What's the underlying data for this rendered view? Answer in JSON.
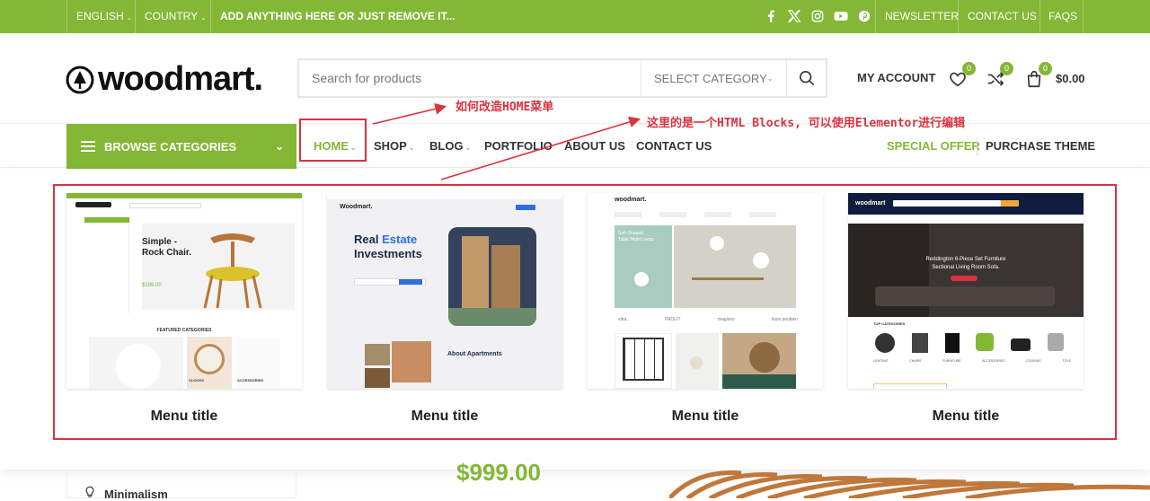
{
  "topbar": {
    "language": "ENGLISH",
    "country": "COUNTRY",
    "promo": "ADD ANYTHING HERE OR JUST REMOVE IT...",
    "links": [
      "NEWSLETTER",
      "CONTACT US",
      "FAQS"
    ],
    "social_icons": [
      "facebook-icon",
      "x-icon",
      "instagram-icon",
      "youtube-icon",
      "pinterest-icon"
    ]
  },
  "header": {
    "logo": "woodmart.",
    "search_placeholder": "Search for products",
    "category_select": "SELECT CATEGORY",
    "account": "MY ACCOUNT",
    "wishlist_count": "0",
    "compare_count": "0",
    "cart_count": "0",
    "cart_total": "$0.00"
  },
  "nav": {
    "browse": "BROWSE CATEGORIES",
    "items": [
      "HOME",
      "SHOP",
      "BLOG",
      "PORTFOLIO",
      "ABOUT US",
      "CONTACT US"
    ],
    "special_offer": "SPECIAL OFFER",
    "purchase_theme": "PURCHASE THEME"
  },
  "annotations": {
    "home_note": "如何改造HOME菜单",
    "blocks_note": "这里的是一个HTML Blocks, 可以使用Elementor进行编辑"
  },
  "menu_cards": [
    {
      "title": "Menu title",
      "demo": "furniture"
    },
    {
      "title": "Menu title",
      "demo": "real-estate"
    },
    {
      "title": "Menu title",
      "demo": "lamp"
    },
    {
      "title": "Menu title",
      "demo": "furniture-dark"
    }
  ],
  "card1": {
    "headline1": "Simple -",
    "headline2": "Rock Chair.",
    "price": "$199.00",
    "section": "FEATURED CATEGORIES",
    "cat1": "CLOCKS",
    "cat2": "ACCESSORIES"
  },
  "card2": {
    "logo": "Woodmart.",
    "headline1": "Real",
    "headline1b": "Estate",
    "headline2": "Investments",
    "section": "About Apartments"
  },
  "card3": {
    "logo": "woodmart.",
    "headline1": "Soft-Shaped",
    "headline2": "Table Night Lamp.",
    "brands": [
      "vitra.",
      "",
      "PAOLIT",
      "",
      "magisso",
      "louis poulsen"
    ]
  },
  "card4": {
    "logo": "woodmart",
    "headline1": "Reddington 6-Piece Set Furniture",
    "headline2": "Sectional Living Room Sofa.",
    "section": "TOP CATEGORIES",
    "cats": [
      "LIGHTING",
      "CHAIRS",
      "FURNITURE",
      "ACCESSORIES",
      "COOKING",
      "TOYS"
    ]
  },
  "below": {
    "sidebar_item": "Minimalism",
    "price": "$999.00"
  },
  "colors": {
    "brand": "#83b735",
    "annotation": "#d9333f"
  }
}
